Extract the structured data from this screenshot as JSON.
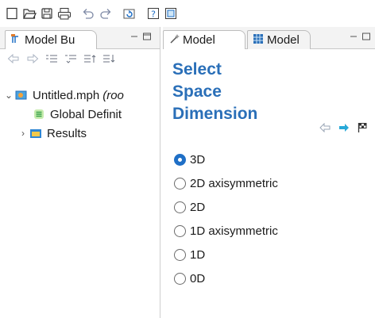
{
  "toolbar": {
    "icons": [
      "new-file-icon",
      "open-folder-icon",
      "save-icon",
      "print-icon",
      "undo-icon",
      "redo-icon",
      "refresh-icon",
      "help-icon",
      "help-book-icon"
    ]
  },
  "left_pane": {
    "tab_label": "Model Bu",
    "tree": {
      "root_label": "Untitled.mph",
      "root_suffix": "(roo",
      "children": [
        {
          "label": "Global Definit"
        },
        {
          "label": "Results"
        }
      ]
    }
  },
  "right_pane": {
    "tabs": [
      {
        "label": "Model"
      },
      {
        "label": "Model"
      }
    ],
    "title_lines": [
      "Select",
      "Space",
      "Dimension"
    ],
    "options": [
      {
        "label": "3D",
        "checked": true
      },
      {
        "label": "2D axisymmetric",
        "checked": false
      },
      {
        "label": "2D",
        "checked": false
      },
      {
        "label": "1D axisymmetric",
        "checked": false
      },
      {
        "label": "1D",
        "checked": false
      },
      {
        "label": "0D",
        "checked": false
      }
    ]
  },
  "colors": {
    "accent_blue": "#2a6fb8",
    "radio_selected": "#1f6fc6",
    "nav_arrow": "#28a9d8"
  }
}
